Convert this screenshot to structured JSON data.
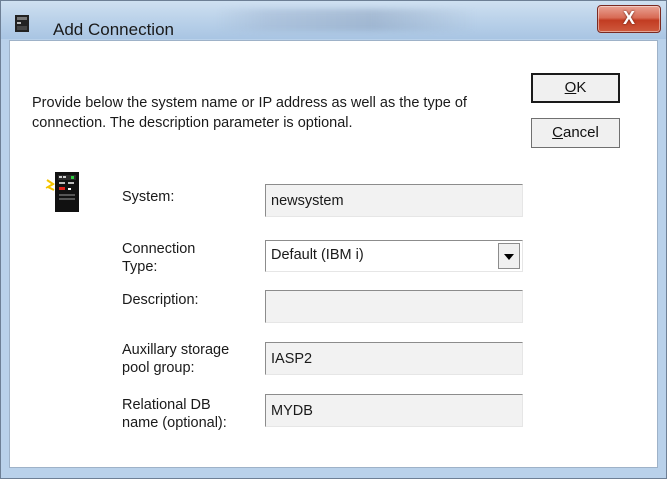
{
  "window": {
    "title": "Add Connection",
    "close_glyph": "X"
  },
  "dialog": {
    "instructions": "Provide below the system name or IP address as well as the type of connection.  The description parameter is optional.",
    "ok_label_rest": "K",
    "ok_mnemonic": "O",
    "cancel_mnemonic": "C",
    "cancel_label_rest": "ancel",
    "icon": "system-connection-icon"
  },
  "form": {
    "system_label": "System:",
    "system_value": "newsystem",
    "connection_type_label_1": "Connection",
    "connection_type_label_2": "Type:",
    "connection_type_value": "Default (IBM i)",
    "description_label": "Description:",
    "description_value": "",
    "asp_label_1": "Auxillary storage",
    "asp_label_2": "pool group:",
    "asp_value": "IASP2",
    "rdb_label_1": "Relational DB",
    "rdb_label_2": "name (optional):",
    "rdb_value": "MYDB"
  },
  "colors": {
    "titlebar": "#bcd3ea",
    "close_button": "#c23c22",
    "client_bg": "#ffffff"
  }
}
